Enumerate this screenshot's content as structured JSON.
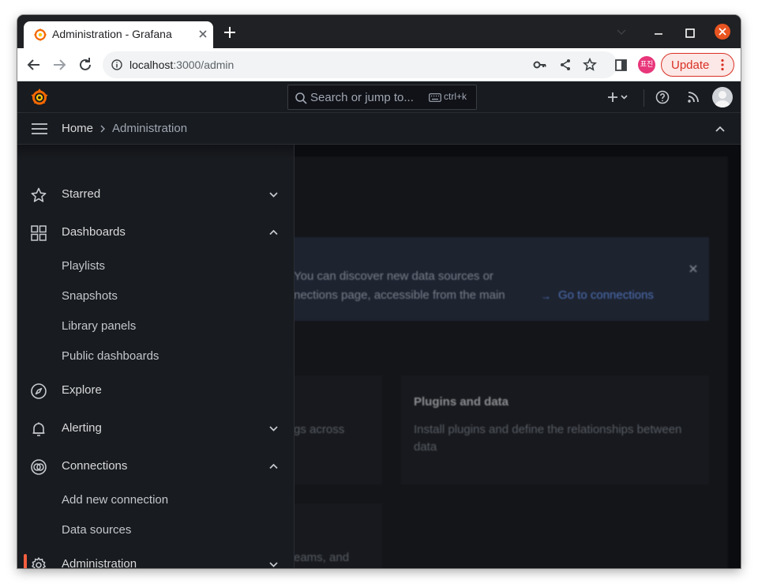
{
  "browser": {
    "tab_title": "Administration - Grafana",
    "url_host": "localhost",
    "url_path": ":3000/admin",
    "profile_initials": "표진",
    "update_label": "Update"
  },
  "grafana": {
    "search_placeholder": "Search or jump to...",
    "search_shortcut": "ctrl+k",
    "breadcrumb": {
      "home": "Home",
      "current": "Administration"
    }
  },
  "side_menu": {
    "starred": "Starred",
    "dashboards": "Dashboards",
    "dashboards_children": [
      "Playlists",
      "Snapshots",
      "Library panels",
      "Public dashboards"
    ],
    "explore": "Explore",
    "alerting": "Alerting",
    "connections": "Connections",
    "connections_children": [
      "Add new connection",
      "Data sources"
    ],
    "administration": "Administration"
  },
  "background_content": {
    "alert_line_1": "You can discover new data sources or",
    "alert_line_2": "nections page, accessible from the main",
    "alert_link": "Go to connections",
    "card_left_fragment": "gs across",
    "plugins_title": "Plugins and data",
    "plugins_text_1": "Install plugins and define the relationships between",
    "plugins_text_2": "data",
    "card_bottom_fragment": "eams, and"
  },
  "colors": {
    "accent": "#f55f3e",
    "link": "#6e9fff",
    "update": "#d93025",
    "window_close": "#e95420"
  }
}
